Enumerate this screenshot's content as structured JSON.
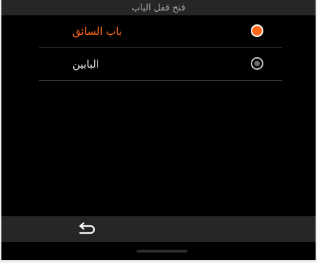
{
  "header": {
    "title": "فتح قفل الباب"
  },
  "options": [
    {
      "label": "باب السائق",
      "selected": true
    },
    {
      "label": "البابين",
      "selected": false
    }
  ],
  "footer": {
    "back_icon": "back-return-icon"
  },
  "colors": {
    "accent": "#ff6a1a",
    "background": "#000000",
    "bar": "#262626",
    "text_default": "#e6e6e6",
    "title_text": "#a6a6a6"
  }
}
